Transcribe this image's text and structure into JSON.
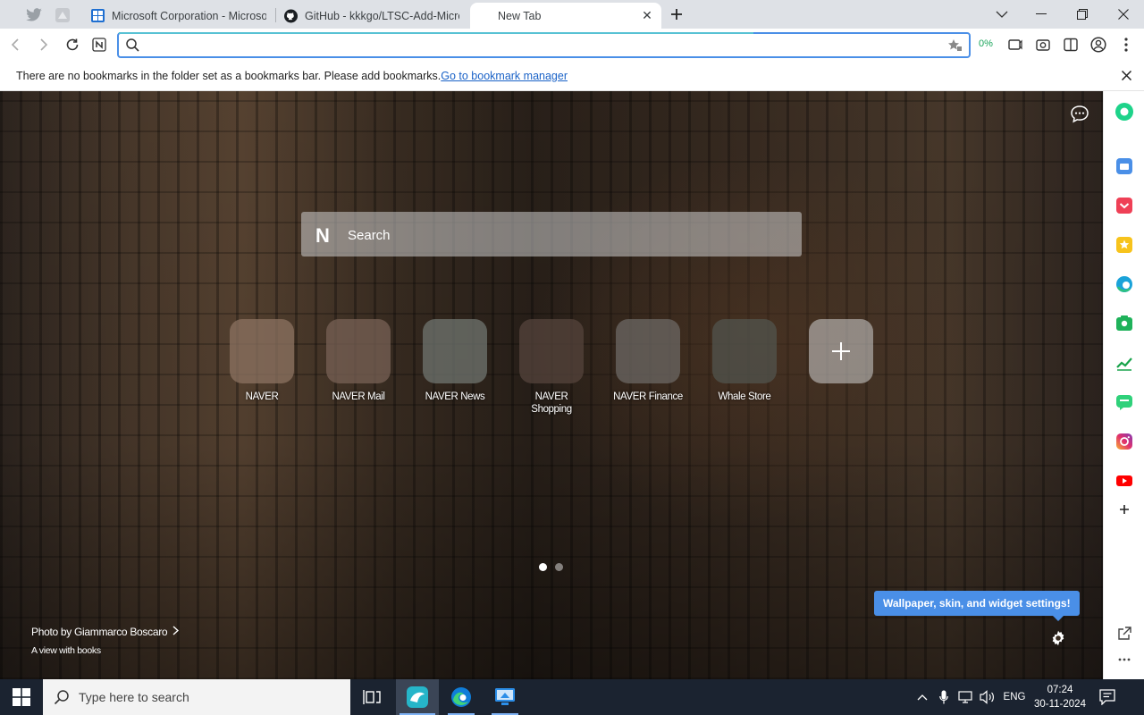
{
  "tabs": [
    {
      "title": "Microsoft Corporation - Microsoft",
      "icon": "microsoft-store-icon"
    },
    {
      "title": "GitHub - kkkgo/LTSC-Add-Microsoft",
      "icon": "github-icon"
    },
    {
      "title": "New Tab",
      "icon": "new-tab-icon"
    }
  ],
  "toolbar": {
    "address_value": "",
    "address_placeholder": "",
    "zoom_percent": "0%"
  },
  "bookmarks_bar": {
    "message": "There are no bookmarks in the folder set as a bookmarks bar. Please add bookmarks.",
    "link": "Go to bookmark manager"
  },
  "newtab": {
    "search_logo": "N",
    "search_placeholder": "Search",
    "shortcuts": [
      {
        "label": "NAVER",
        "color": "#6e5a4c"
      },
      {
        "label": "NAVER Mail",
        "color": "#5d4d43"
      },
      {
        "label": "NAVER News",
        "color": "#4f5450"
      },
      {
        "label": "NAVER Shopping",
        "color": "#3f332c"
      },
      {
        "label": "NAVER Finance",
        "color": "#4d4a47"
      },
      {
        "label": "Whale Store",
        "color": "#3a3b37"
      }
    ],
    "add_shortcut": "+",
    "photo_credit": "Photo by Giammarco Boscaro",
    "photo_caption": "A view with books",
    "settings_tooltip": "Wallpaper, skin, and widget settings!"
  },
  "sidebar_items": [
    "whale-space-icon",
    "calendar-icon",
    "pocket-icon",
    "favorites-icon",
    "edge-translate-icon",
    "naver-widget-icon",
    "stock-chart-icon",
    "talk-icon",
    "instagram-icon",
    "youtube-icon",
    "add-icon"
  ],
  "taskbar": {
    "search_placeholder": "Type here to search",
    "language": "ENG",
    "time": "07:24",
    "date": "30-11-2024"
  },
  "colors": {
    "accent": "#4a8fe7",
    "taskbar": "#1b2330",
    "tab_strip": "#dee1e6"
  }
}
